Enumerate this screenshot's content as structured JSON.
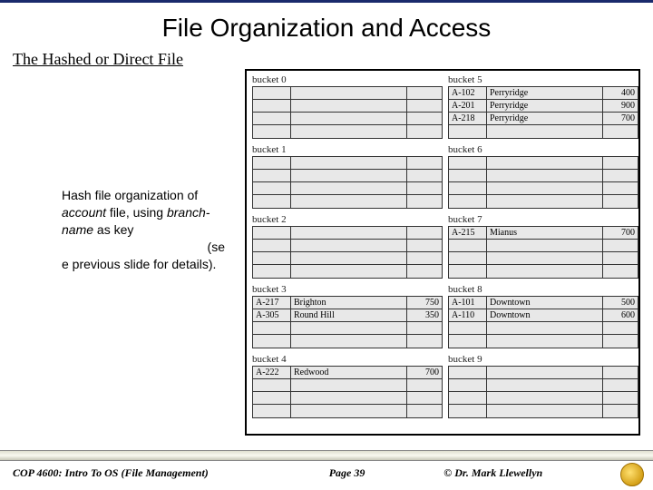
{
  "title": "File Organization and Access",
  "subtitle": "The Hashed or Direct File",
  "caption": {
    "l1": "Hash file organization of ",
    "it1": "account",
    "l2": " file, using ",
    "it2": "branch-name",
    "l3": " as key",
    "l4": "(se",
    "l5": "e previous slide for details)."
  },
  "buckets_left": [
    {
      "label": "bucket 0",
      "rows": [
        [
          "",
          "",
          ""
        ],
        [
          "",
          "",
          ""
        ],
        [
          "",
          "",
          ""
        ],
        [
          "",
          "",
          ""
        ]
      ]
    },
    {
      "label": "bucket 1",
      "rows": [
        [
          "",
          "",
          ""
        ],
        [
          "",
          "",
          ""
        ],
        [
          "",
          "",
          ""
        ],
        [
          "",
          "",
          ""
        ]
      ]
    },
    {
      "label": "bucket 2",
      "rows": [
        [
          "",
          "",
          ""
        ],
        [
          "",
          "",
          ""
        ],
        [
          "",
          "",
          ""
        ],
        [
          "",
          "",
          ""
        ]
      ]
    },
    {
      "label": "bucket 3",
      "rows": [
        [
          "A-217",
          "Brighton",
          "750"
        ],
        [
          "A-305",
          "Round Hill",
          "350"
        ],
        [
          "",
          "",
          ""
        ],
        [
          "",
          "",
          ""
        ]
      ]
    },
    {
      "label": "bucket 4",
      "rows": [
        [
          "A-222",
          "Redwood",
          "700"
        ],
        [
          "",
          "",
          ""
        ],
        [
          "",
          "",
          ""
        ],
        [
          "",
          "",
          ""
        ]
      ]
    }
  ],
  "buckets_right": [
    {
      "label": "bucket 5",
      "rows": [
        [
          "A-102",
          "Perryridge",
          "400"
        ],
        [
          "A-201",
          "Perryridge",
          "900"
        ],
        [
          "A-218",
          "Perryridge",
          "700"
        ],
        [
          "",
          "",
          ""
        ]
      ]
    },
    {
      "label": "bucket 6",
      "rows": [
        [
          "",
          "",
          ""
        ],
        [
          "",
          "",
          ""
        ],
        [
          "",
          "",
          ""
        ],
        [
          "",
          "",
          ""
        ]
      ]
    },
    {
      "label": "bucket 7",
      "rows": [
        [
          "A-215",
          "Mianus",
          "700"
        ],
        [
          "",
          "",
          ""
        ],
        [
          "",
          "",
          ""
        ],
        [
          "",
          "",
          ""
        ]
      ]
    },
    {
      "label": "bucket 8",
      "rows": [
        [
          "A-101",
          "Downtown",
          "500"
        ],
        [
          "A-110",
          "Downtown",
          "600"
        ],
        [
          "",
          "",
          ""
        ],
        [
          "",
          "",
          ""
        ]
      ]
    },
    {
      "label": "bucket 9",
      "rows": [
        [
          "",
          "",
          ""
        ],
        [
          "",
          "",
          ""
        ],
        [
          "",
          "",
          ""
        ],
        [
          "",
          "",
          ""
        ]
      ]
    }
  ],
  "footer": {
    "course": "COP 4600: Intro To OS  (File Management)",
    "page": "Page 39",
    "author": "© Dr. Mark Llewellyn"
  }
}
